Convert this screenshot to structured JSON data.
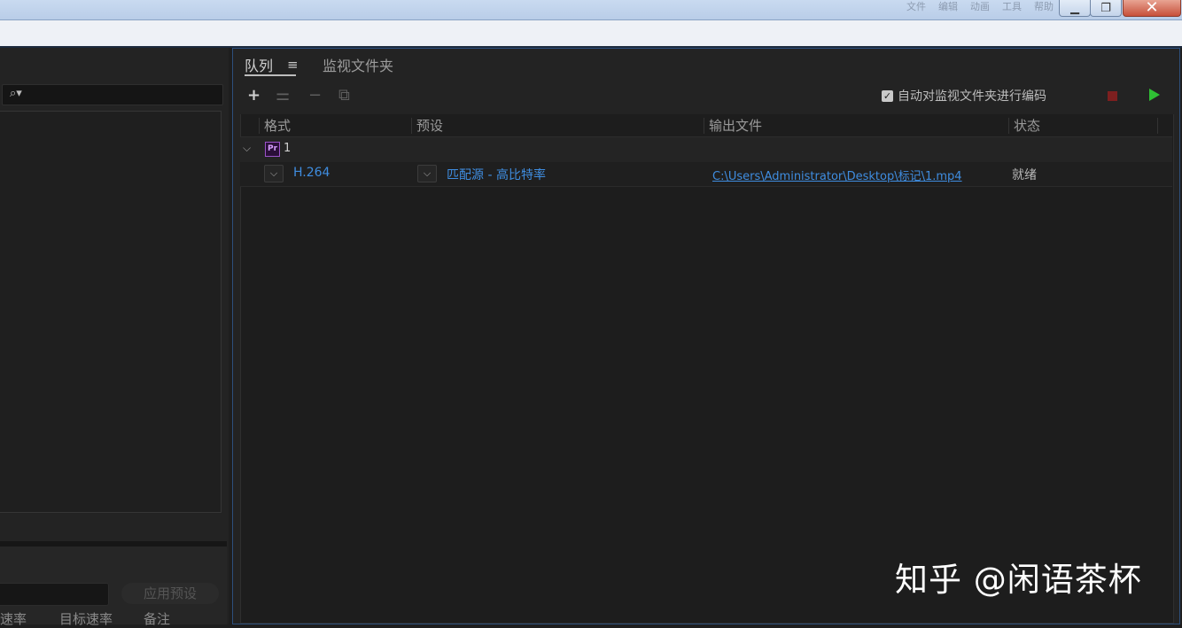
{
  "window": {
    "menu_items": [
      "文件",
      "编辑",
      "动画",
      "工具",
      "帮助"
    ],
    "minimize_glyph": "▁",
    "maximize_glyph": "❐",
    "close_glyph": "✕"
  },
  "left_panel": {
    "search_icon": "search-icon",
    "apply_preset_label": "应用预设",
    "columns": [
      "速率",
      "目标速率",
      "备注"
    ]
  },
  "queue": {
    "tabs": [
      {
        "label": "队列",
        "active": true
      },
      {
        "label": "监视文件夹",
        "active": false
      }
    ],
    "tab_menu_glyph": "≡",
    "toolbar": {
      "add_glyph": "+",
      "settings_glyph": "⚌",
      "remove_glyph": "−",
      "duplicate_glyph": "⧉"
    },
    "auto_encode": {
      "checked": true,
      "check_glyph": "✓",
      "label": "自动对监视文件夹进行编码"
    },
    "columns": [
      "格式",
      "预设",
      "输出文件",
      "状态"
    ],
    "groups": [
      {
        "chevron": "⌵",
        "app_badge": "Pr",
        "label": "1",
        "items": [
          {
            "format": "H.264",
            "preset": "匹配源 - 高比特率",
            "output": "C:\\Users\\Administrator\\Desktop\\标记\\1.mp4",
            "status": "就绪",
            "dropdown_glyph": "⌵"
          }
        ]
      }
    ]
  },
  "colors": {
    "accent_link": "#3f8de0",
    "start_green": "#2fbf34",
    "stop_red": "#7d1f1f",
    "panel_border_blue": "#2d4f7c"
  },
  "watermark": "知乎 @闲语茶杯"
}
